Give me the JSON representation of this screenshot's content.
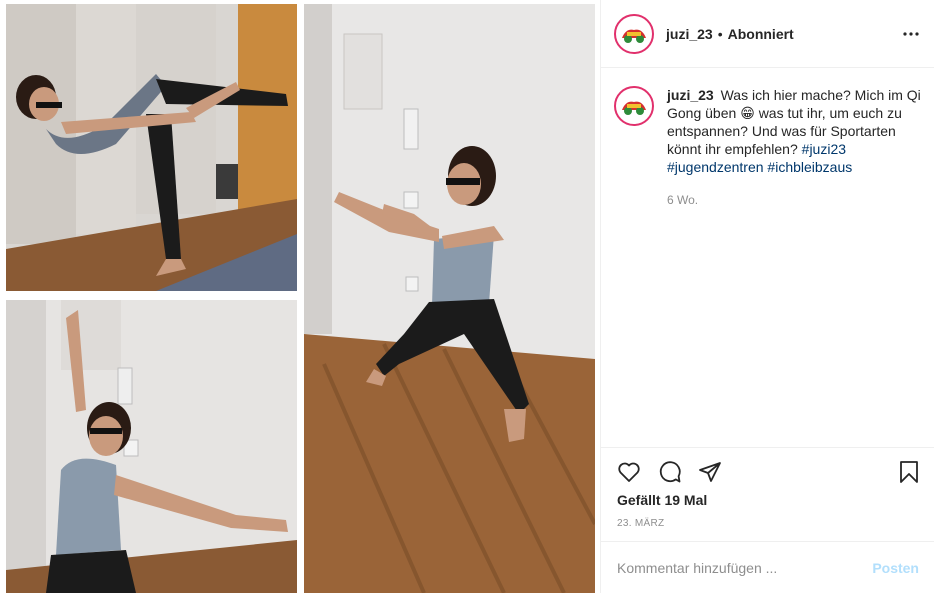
{
  "header": {
    "username": "juzi_23",
    "separator": "•",
    "follow_status": "Abonniert"
  },
  "caption": {
    "username": "juzi_23",
    "text_before_emoji": "Was ich hier mache? Mich im Qi Gong üben",
    "emoji": "😁",
    "text_after_emoji": "was tut ihr, um euch zu entspannen? Und was für Sportarten könnt ihr empfehlen?",
    "hashtags": [
      "#juzi23",
      "#jugendzentren",
      "#ichbleibzaus"
    ],
    "time_ago": "6 Wo."
  },
  "engagement": {
    "likes_text": "Gefällt 19 Mal",
    "date": "23. März"
  },
  "comment": {
    "placeholder": "Kommentar hinzufügen ...",
    "post_label": "Posten"
  },
  "icons": {
    "more": "more-options-icon",
    "like": "heart-icon",
    "comment": "comment-bubble-icon",
    "share": "paper-plane-icon",
    "save": "bookmark-icon"
  },
  "colors": {
    "hashtag": "#00376b",
    "muted": "#8e8e8e",
    "post_disabled": "#b2dffc",
    "avatar_ring": "#e1306c"
  }
}
